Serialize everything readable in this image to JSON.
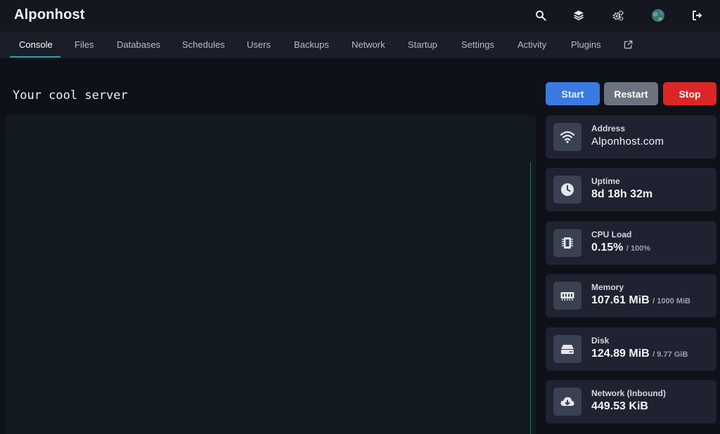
{
  "app": {
    "title": "Alponhost"
  },
  "header_icons": [
    "search-icon",
    "layers-icon",
    "gears-icon",
    "avatar",
    "logout-icon"
  ],
  "nav": {
    "items": [
      {
        "label": "Console",
        "active": true
      },
      {
        "label": "Files"
      },
      {
        "label": "Databases"
      },
      {
        "label": "Schedules"
      },
      {
        "label": "Users"
      },
      {
        "label": "Backups"
      },
      {
        "label": "Network"
      },
      {
        "label": "Startup"
      },
      {
        "label": "Settings"
      },
      {
        "label": "Activity"
      },
      {
        "label": "Plugins"
      }
    ],
    "external_icon": "external-link-icon"
  },
  "server": {
    "name": "Your cool server"
  },
  "power": {
    "start": "Start",
    "restart": "Restart",
    "stop": "Stop"
  },
  "stats": [
    {
      "label": "Address",
      "value": "Alponhost.com",
      "limit": "",
      "icon": "wifi-icon"
    },
    {
      "label": "Uptime",
      "value": "8d 18h 32m",
      "limit": "",
      "icon": "clock-icon"
    },
    {
      "label": "CPU Load",
      "value": "0.15%",
      "limit": "/ 100%",
      "icon": "cpu-icon"
    },
    {
      "label": "Memory",
      "value": "107.61 MiB",
      "limit": "/ 1000 MiB",
      "icon": "memory-icon"
    },
    {
      "label": "Disk",
      "value": "124.89 MiB",
      "limit": "/ 9.77 GiB",
      "icon": "hdd-icon"
    },
    {
      "label": "Network (Inbound)",
      "value": "449.53 KiB",
      "limit": "",
      "icon": "cloud-download-icon"
    }
  ],
  "colors": {
    "accent": "#2aa0b4",
    "start": "#3b7ae0",
    "restart": "#6b7380",
    "stop": "#dc2626"
  }
}
